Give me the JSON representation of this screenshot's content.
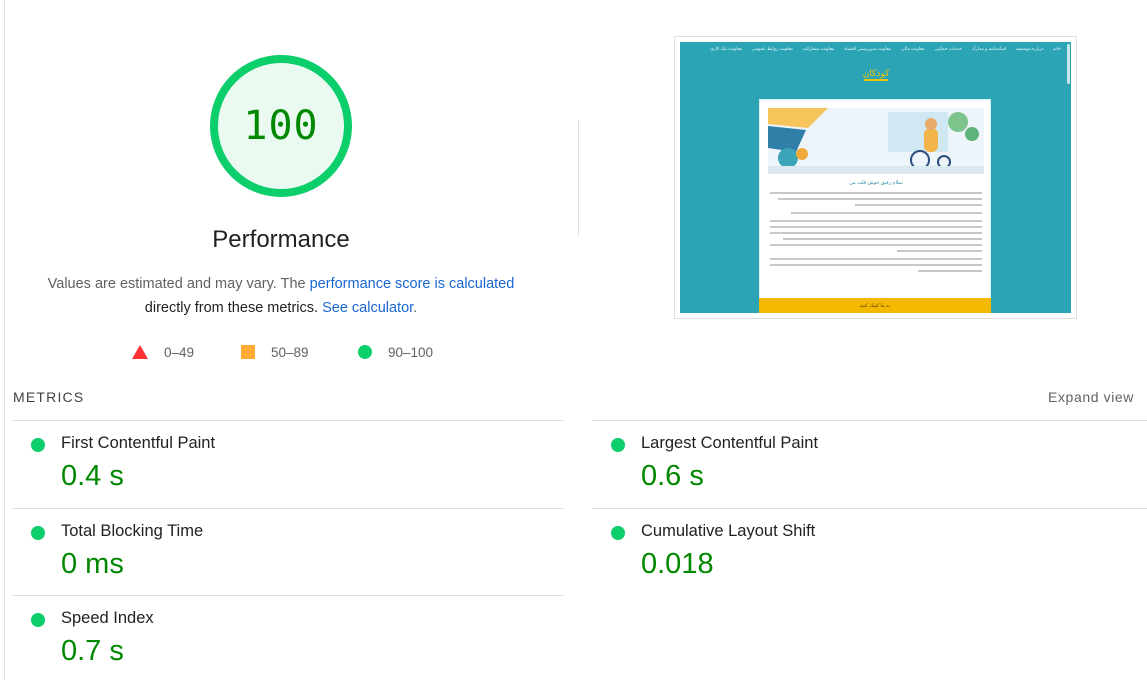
{
  "performance": {
    "score": "100",
    "score_fraction": 1.0,
    "title": "Performance",
    "description_prefix": "Values are estimated and may vary. The ",
    "link_score_calc": "performance score is calculated",
    "description_mid": "directly from these metrics.",
    "link_calculator": "See calculator",
    "description_suffix": ".",
    "colors": {
      "pass": "#0cce6b",
      "pass_text": "#008800",
      "average": "#ffaa33",
      "fail": "#ff3333",
      "link": "#1967d2"
    }
  },
  "legend": [
    {
      "range": "0–49",
      "icon": "triangle-fail-icon"
    },
    {
      "range": "50–89",
      "icon": "square-average-icon"
    },
    {
      "range": "90–100",
      "icon": "circle-pass-icon"
    }
  ],
  "thumbnail": {
    "nav_items": [
      "خانه",
      "درباره موسسه",
      "اساسنامه و مدارک",
      "خدمات حمایتی",
      "معاونت مالی",
      "معاونت سرپرستی اقتصاد",
      "معاونت مشارکت",
      "معاونت روابط عمومی",
      "معاونت نیک کاری"
    ],
    "logo_text": "کودکان",
    "card_title": "سلام رفیق خوش قلب من",
    "cta_text": "به ما کمک کنید"
  },
  "metrics": {
    "header": "METRICS",
    "expand_label": "Expand view",
    "items": [
      {
        "label": "First Contentful Paint",
        "value": "0.4 s"
      },
      {
        "label": "Largest Contentful Paint",
        "value": "0.6 s"
      },
      {
        "label": "Total Blocking Time",
        "value": "0 ms"
      },
      {
        "label": "Cumulative Layout Shift",
        "value": "0.018"
      },
      {
        "label": "Speed Index",
        "value": "0.7 s"
      }
    ]
  }
}
